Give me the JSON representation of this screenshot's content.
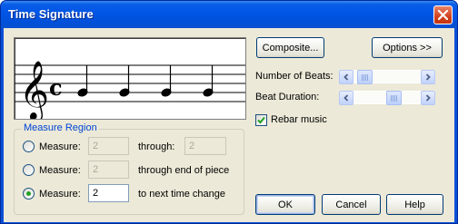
{
  "window": {
    "title": "Time Signature"
  },
  "preview": {
    "time_symbol": "common-time",
    "note_count": 4
  },
  "buttons": {
    "composite": "Composite...",
    "options": "Options >>",
    "ok": "OK",
    "cancel": "Cancel",
    "help": "Help"
  },
  "beats": {
    "num_beats_label": "Number of Beats:",
    "beat_duration_label": "Beat Duration:"
  },
  "rebar": {
    "label": "Rebar music",
    "checked": true
  },
  "measure_region": {
    "title": "Measure Region",
    "row1": {
      "label": "Measure:",
      "start": "2",
      "connector": "through:",
      "end": "2",
      "selected": false
    },
    "row2": {
      "label": "Measure:",
      "start": "2",
      "connector": "through end of piece",
      "selected": false
    },
    "row3": {
      "label": "Measure:",
      "start": "2",
      "connector": "to next time change",
      "selected": true
    }
  }
}
